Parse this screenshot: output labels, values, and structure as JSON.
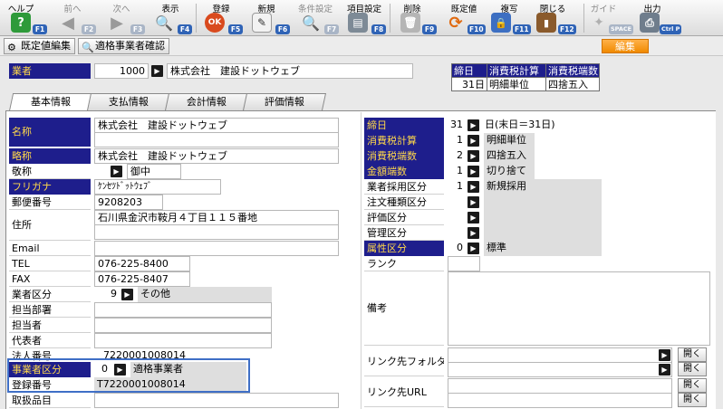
{
  "toolbar": {
    "items": [
      {
        "label": "ヘルプ",
        "key": "F1",
        "icon": "help-icon",
        "enabled": true
      },
      {
        "label": "前へ",
        "key": "F2",
        "icon": "arrow-left-icon",
        "enabled": false
      },
      {
        "label": "次へ",
        "key": "F3",
        "icon": "arrow-right-icon",
        "enabled": false
      },
      {
        "label": "表示",
        "key": "F4",
        "icon": "search-icon",
        "enabled": true
      },
      {
        "label": "登録",
        "key": "F5",
        "icon": "ok-icon",
        "enabled": true
      },
      {
        "label": "新規",
        "key": "F6",
        "icon": "new-document-icon",
        "enabled": true
      },
      {
        "label": "条件設定",
        "key": "F7",
        "icon": "filter-search-icon",
        "enabled": false
      },
      {
        "label": "項目設定",
        "key": "F8",
        "icon": "item-settings-icon",
        "enabled": true
      },
      {
        "label": "削除",
        "key": "F9",
        "icon": "trash-icon",
        "enabled": true
      },
      {
        "label": "既定値",
        "key": "F10",
        "icon": "refresh-icon",
        "enabled": true
      },
      {
        "label": "複写",
        "key": "F11",
        "icon": "copy-lock-icon",
        "enabled": true
      },
      {
        "label": "閉じる",
        "key": "F12",
        "icon": "close-door-icon",
        "enabled": true
      },
      {
        "label": "ガイド",
        "key": "SPACE",
        "icon": "guide-icon",
        "enabled": false
      },
      {
        "label": "出力",
        "key": "Ctrl P",
        "icon": "print-icon",
        "enabled": true
      }
    ]
  },
  "subbar": {
    "default_edit": "既定値編集",
    "qualified_check": "適格事業者確認",
    "edit": "編集"
  },
  "header": {
    "vendor_label": "業者",
    "vendor_code": "1000",
    "vendor_name": "株式会社　建設ドットウェブ"
  },
  "summary": {
    "headers": [
      "締日",
      "消費税計算",
      "消費税端数"
    ],
    "values": [
      "31日",
      "明細単位",
      "四捨五入"
    ]
  },
  "tabs": [
    "基本情報",
    "支払情報",
    "会計情報",
    "評価情報"
  ],
  "left": {
    "name_label": "名称",
    "name_value": "株式会社　建設ドットウェブ",
    "short_label": "略称",
    "short_value": "株式会社　建設ドットウェブ",
    "honorific_label": "敬称",
    "honorific_value": "御中",
    "kana_label": "フリガナ",
    "kana_value": "ｹﾝｾﾂﾄﾞｯﾄｳｪﾌﾞ",
    "zip_label": "郵便番号",
    "zip_value": "9208203",
    "address_label": "住所",
    "address_value": "石川県金沢市鞍月４丁目１１５番地",
    "email_label": "Email",
    "tel_label": "TEL",
    "tel_value": "076-225-8400",
    "fax_label": "FAX",
    "fax_value": "076-225-8407",
    "category_label": "業者区分",
    "category_code": "9",
    "category_value": "その他",
    "dept_label": "担当部署",
    "person_label": "担当者",
    "rep_label": "代表者",
    "corp_label": "法人番号",
    "corp_value": "7220001008014",
    "biz_label": "事業者区分",
    "biz_code": "0",
    "biz_value": "適格事業者",
    "reg_label": "登録番号",
    "reg_value": "T7220001008014",
    "items_label": "取扱品目"
  },
  "right": {
    "closing_label": "締日",
    "closing_code": "31",
    "closing_value": "日(末日＝31日)",
    "tax_calc_label": "消費税計算",
    "tax_calc_code": "1",
    "tax_calc_value": "明細単位",
    "tax_round_label": "消費税端数",
    "tax_round_code": "2",
    "tax_round_value": "四捨五入",
    "amount_round_label": "金額端数",
    "amount_round_code": "1",
    "amount_round_value": "切り捨て",
    "adopt_label": "業者採用区分",
    "adopt_code": "1",
    "adopt_value": "新規採用",
    "order_label": "注文種類区分",
    "eval_label": "評価区分",
    "manage_label": "管理区分",
    "attr_label": "属性区分",
    "attr_code": "0",
    "attr_value": "標準",
    "rank_label": "ランク",
    "notes_label": "備考",
    "link_folder_label": "リンク先フォルダー",
    "link_url_label": "リンク先URL",
    "open_label": "開く"
  }
}
